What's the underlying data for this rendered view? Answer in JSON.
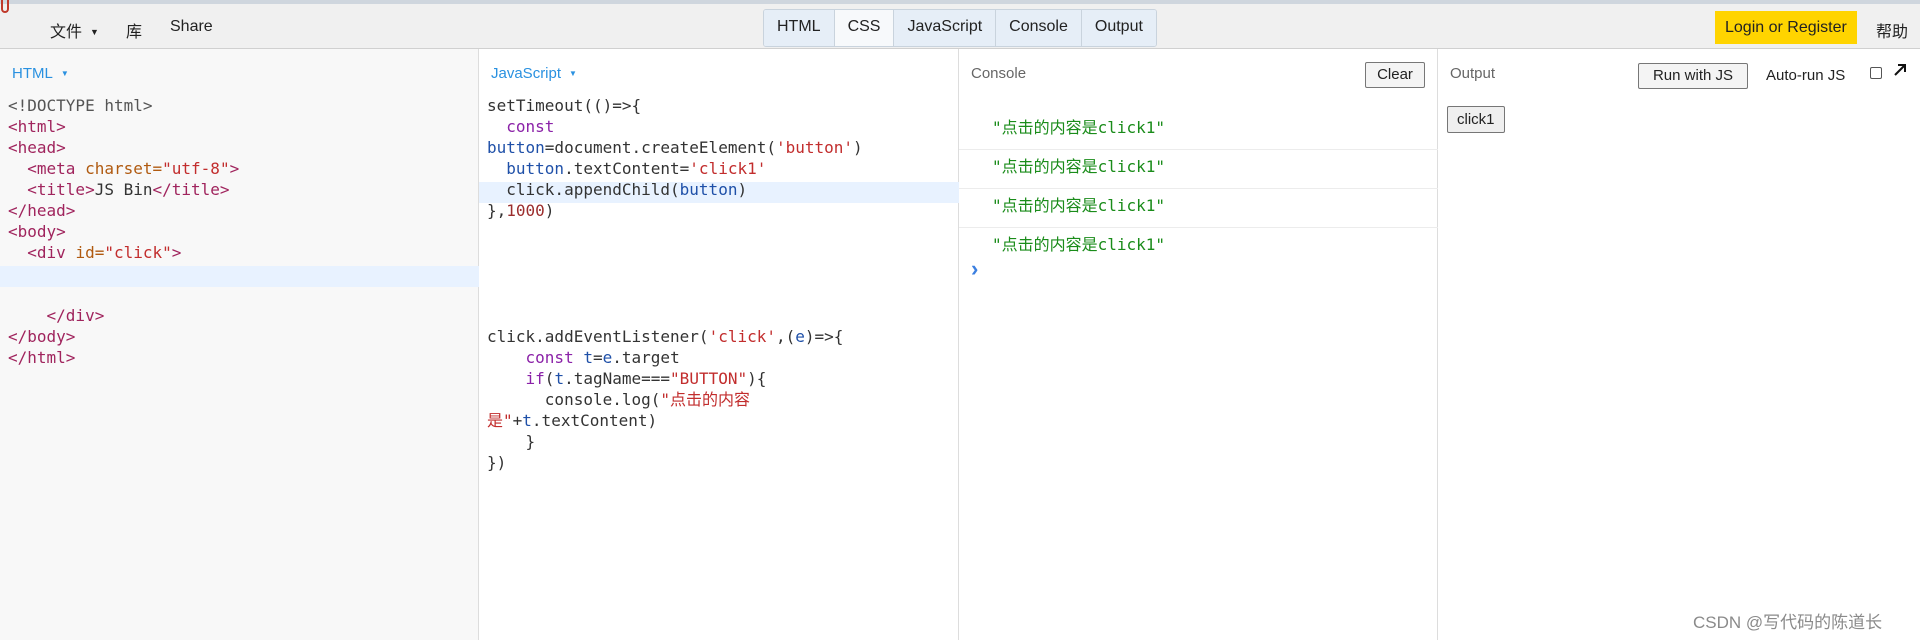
{
  "topbar": {
    "file_label": "文件",
    "library_label": "库",
    "share_label": "Share",
    "tabs": [
      "HTML",
      "CSS",
      "JavaScript",
      "Console",
      "Output"
    ],
    "login_label": "Login or Register",
    "help_label": "帮助",
    "accent_color": "#ffd400"
  },
  "html_panel": {
    "label": "HTML",
    "lines": [
      "<!DOCTYPE html>",
      "<html>",
      "<head>",
      "  <meta charset=\"utf-8\">",
      "  <title>JS Bin</title>",
      "</head>",
      "<body>",
      "  <div id=\"click\">",
      "",
      "",
      "    </div>",
      "</body>",
      "</html>"
    ]
  },
  "js_panel": {
    "label": "JavaScript",
    "lines": [
      "setTimeout(()=>{",
      "  const",
      "button=document.createElement('button')",
      "  button.textContent='click1'",
      "  click.appendChild(button)",
      "},1000)",
      "",
      "",
      "",
      "",
      "",
      "click.addEventListener('click',(e)=>{",
      "    const t=e.target",
      "    if(t.tagName===\"BUTTON\"){",
      "      console.log(\"点击的内容",
      "是\"+t.textContent)",
      "    }",
      "})"
    ]
  },
  "console_panel": {
    "label": "Console",
    "clear_label": "Clear",
    "logs": [
      "\"点击的内容是click1\"",
      "\"点击的内容是click1\"",
      "\"点击的内容是click1\"",
      "\"点击的内容是click1\""
    ],
    "prompt": "›"
  },
  "output_panel": {
    "label": "Output",
    "run_label": "Run with JS",
    "autorun_label": "Auto-run JS",
    "autorun_checked": false,
    "rendered_button_label": "click1"
  },
  "watermark": "CSDN @写代码的陈道长"
}
